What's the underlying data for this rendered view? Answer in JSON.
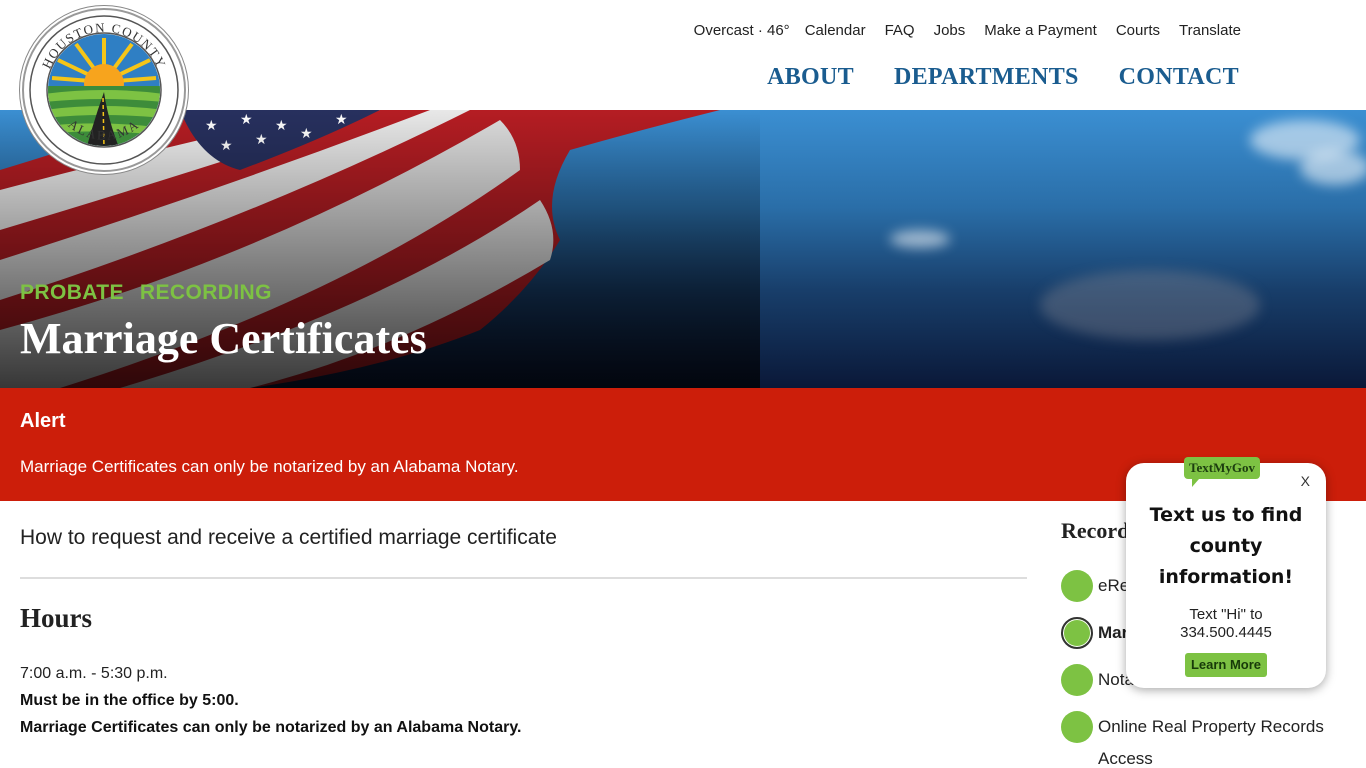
{
  "header": {
    "seal_text_top": "HOUSTON COUNTY",
    "seal_text_bottom": "ALABAMA",
    "utility_nav": {
      "weather": "Overcast · 46°",
      "calendar": "Calendar",
      "faq": "FAQ",
      "jobs": "Jobs",
      "make_payment": "Make a Payment",
      "courts": "Courts",
      "translate": "Translate"
    },
    "main_nav": {
      "about": "ABOUT",
      "departments": "DEPARTMENTS",
      "contact": "CONTACT"
    }
  },
  "hero": {
    "breadcrumb": [
      "PROBATE",
      "RECORDING"
    ],
    "title": "Marriage Certificates"
  },
  "alert": {
    "title": "Alert",
    "text": "Marriage Certificates can only be notarized by an Alabama Notary."
  },
  "main": {
    "intro": "How to request and receive a certified marriage certificate",
    "hours_heading": "Hours",
    "hours_time": "7:00 a.m. - 5:30 p.m.",
    "hours_note1": "Must be in the office by 5:00.",
    "hours_note2": "Marriage Certificates can only be notarized by an Alabama Notary."
  },
  "sidebar": {
    "heading": "Record",
    "items": [
      {
        "label": "eRe"
      },
      {
        "label": "Mar"
      },
      {
        "label": "Nota"
      },
      {
        "label": "Online Real Property Records Access"
      }
    ]
  },
  "textmygov": {
    "logo": "TextMyGov",
    "close": "X",
    "title": "Text us to find county information!",
    "text_line1": "Text \"Hi\" to",
    "text_line2": "334.500.4445",
    "button": "Learn More"
  },
  "colors": {
    "accent_green": "#7dc243",
    "nav_blue": "#1a5c8f",
    "alert_red": "#cc1e0a"
  }
}
